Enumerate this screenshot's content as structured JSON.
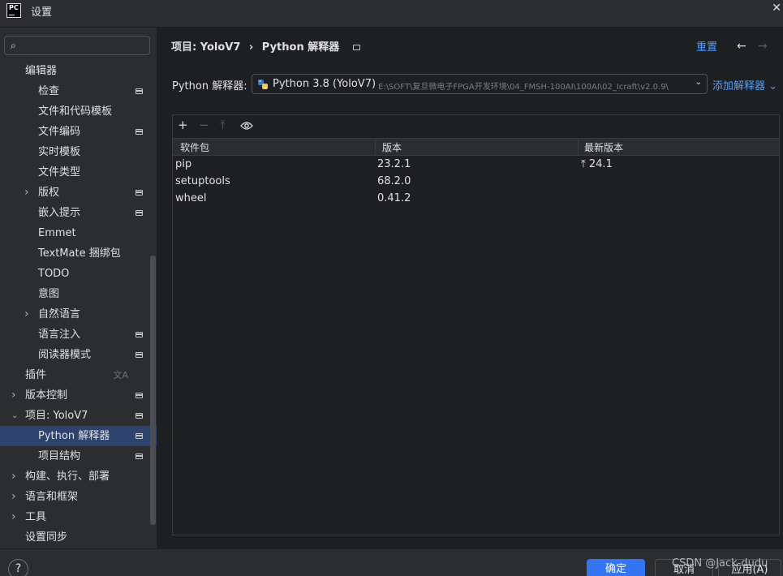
{
  "window": {
    "logo_text": "PC",
    "title": "设置"
  },
  "search": {
    "placeholder": "",
    "value": ""
  },
  "sidebar": {
    "items": [
      {
        "label": "编辑器",
        "expander": "none",
        "badge": false,
        "selected": false
      },
      {
        "label": "检查",
        "expander": "none",
        "badge": true,
        "selected": false
      },
      {
        "label": "文件和代码模板",
        "expander": "none",
        "badge": false,
        "selected": false
      },
      {
        "label": "文件编码",
        "expander": "none",
        "badge": true,
        "selected": false
      },
      {
        "label": "实时模板",
        "expander": "none",
        "badge": false,
        "selected": false
      },
      {
        "label": "文件类型",
        "expander": "none",
        "badge": false,
        "selected": false
      },
      {
        "label": "版权",
        "expander": "collapsed",
        "badge": true,
        "selected": false
      },
      {
        "label": "嵌入提示",
        "expander": "none",
        "badge": true,
        "selected": false
      },
      {
        "label": "Emmet",
        "expander": "none",
        "badge": false,
        "selected": false
      },
      {
        "label": "TextMate 捆绑包",
        "expander": "none",
        "badge": false,
        "selected": false
      },
      {
        "label": "TODO",
        "expander": "none",
        "badge": false,
        "selected": false
      },
      {
        "label": "意图",
        "expander": "none",
        "badge": false,
        "selected": false
      },
      {
        "label": "自然语言",
        "expander": "collapsed",
        "badge": false,
        "selected": false
      },
      {
        "label": "语言注入",
        "expander": "none",
        "badge": true,
        "selected": false
      },
      {
        "label": "阅读器模式",
        "expander": "none",
        "badge": true,
        "selected": false
      },
      {
        "label": "插件",
        "expander": "none",
        "badge": false,
        "selected": false,
        "translate_icon": true
      },
      {
        "label": "版本控制",
        "expander": "collapsed",
        "badge": true,
        "selected": false
      },
      {
        "label": "项目: YoloV7",
        "expander": "expanded",
        "badge": true,
        "selected": false
      },
      {
        "label": "Python 解释器",
        "expander": "none",
        "badge": true,
        "selected": true
      },
      {
        "label": "项目结构",
        "expander": "none",
        "badge": true,
        "selected": false
      },
      {
        "label": "构建、执行、部署",
        "expander": "collapsed",
        "badge": false,
        "selected": false
      },
      {
        "label": "语言和框架",
        "expander": "collapsed",
        "badge": false,
        "selected": false
      },
      {
        "label": "工具",
        "expander": "collapsed",
        "badge": false,
        "selected": false
      },
      {
        "label": "设置同步",
        "expander": "none",
        "badge": false,
        "selected": false
      }
    ]
  },
  "header": {
    "breadcrumb": [
      "项目: YoloV7",
      "›",
      "Python 解释器"
    ],
    "reset_label": "重置"
  },
  "interpreter": {
    "label": "Python 解释器:",
    "name": "Python 3.8 (YoloV7)",
    "path": "E:\\SOFT\\复旦微电子FPGA开发环境\\04_FMSH-100AI\\100AI\\02_Icraft\\v2.0.9\\",
    "add_label": "添加解释器"
  },
  "packages": {
    "columns": [
      "软件包",
      "版本",
      "最新版本"
    ],
    "rows": [
      {
        "name": "pip",
        "version": "23.2.1",
        "latest": "24.1",
        "upgrade": true
      },
      {
        "name": "setuptools",
        "version": "68.2.0",
        "latest": "",
        "upgrade": false
      },
      {
        "name": "wheel",
        "version": "0.41.2",
        "latest": "",
        "upgrade": false
      }
    ]
  },
  "footer": {
    "help_label": "?",
    "ok_label": "确定",
    "cancel_label": "取消",
    "apply_label": "应用(A)",
    "watermark": "CSDN @Jack-dudu"
  },
  "colors": {
    "background": "#1e1f22",
    "panel": "#2b2d30",
    "selection": "#2e436e",
    "accent": "#3574f0",
    "link": "#589df6"
  }
}
